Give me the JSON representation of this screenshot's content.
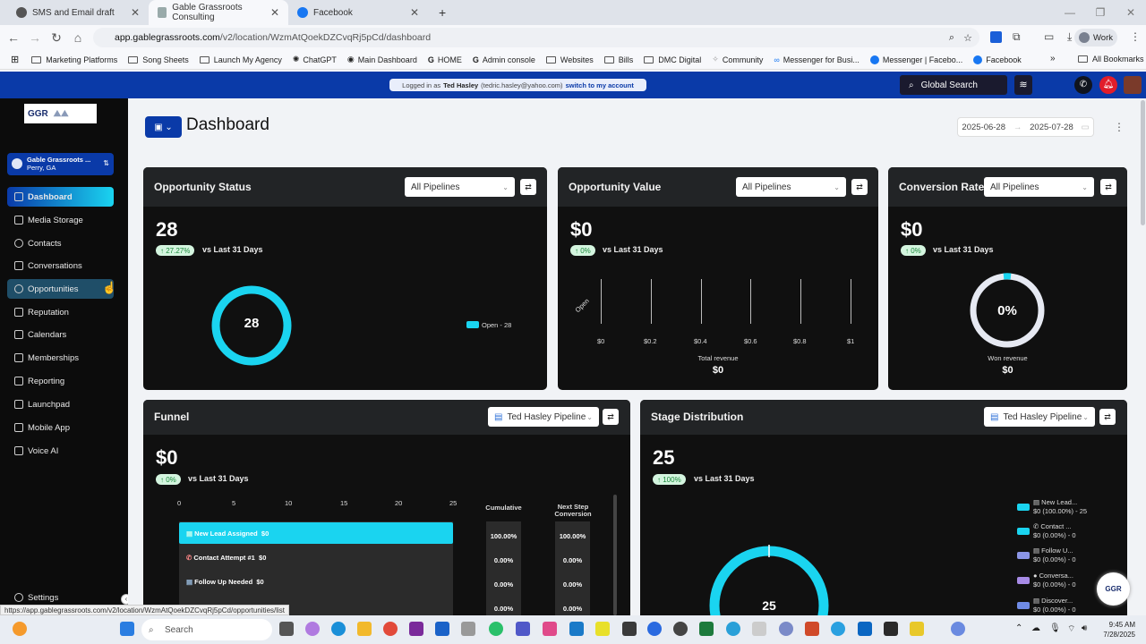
{
  "browser": {
    "tabs": [
      {
        "label": "SMS and Email draft"
      },
      {
        "label": "Gable Grassroots Consulting"
      },
      {
        "label": "Facebook"
      }
    ],
    "url_host": "app.gablegrassroots.com",
    "url_path": "/v2/location/WzmAtQoekDZCvqRj5pCd/dashboard",
    "profile": "Work",
    "bookmarks": [
      "Marketing Platforms",
      "Song Sheets",
      "Launch My Agency",
      "ChatGPT",
      "Main Dashboard",
      "HOME",
      "Admin console",
      "Websites",
      "Bills",
      "DMC Digital",
      "Community",
      "Messenger for Busi...",
      "Messenger | Facebo...",
      "Facebook"
    ],
    "all_bookmarks": "All Bookmarks"
  },
  "banner": {
    "prefix": "Logged in as",
    "user": "Ted Hasley",
    "email": "(tedric.hasley@yahoo.com)",
    "switch": "switch to my account"
  },
  "header": {
    "search": "Global Search"
  },
  "sidebar": {
    "logo": "GGR",
    "account_name": "Gable Grassroots ...",
    "account_loc": "Perry, GA",
    "items": [
      {
        "label": "Dashboard"
      },
      {
        "label": "Media Storage"
      },
      {
        "label": "Contacts"
      },
      {
        "label": "Conversations"
      },
      {
        "label": "Opportunities"
      },
      {
        "label": "Reputation"
      },
      {
        "label": "Calendars"
      },
      {
        "label": "Memberships"
      },
      {
        "label": "Reporting"
      },
      {
        "label": "Launchpad"
      },
      {
        "label": "Mobile App"
      },
      {
        "label": "Voice AI"
      }
    ],
    "settings": "Settings"
  },
  "page": {
    "title": "Dashboard",
    "date_from": "2025-06-28",
    "date_to": "2025-07-28"
  },
  "opp_status": {
    "title": "Opportunity Status",
    "select": "All Pipelines",
    "value": "28",
    "change": "↑ 27.27%",
    "vs": "vs Last 31 Days",
    "center": "28",
    "legend": "Open - 28"
  },
  "opp_value": {
    "title": "Opportunity Value",
    "select": "All Pipelines",
    "value": "$0",
    "change": "↑ 0%",
    "vs": "vs Last 31 Days",
    "ylabel": "Open",
    "xticks": [
      "$0",
      "$0.2",
      "$0.4",
      "$0.6",
      "$0.8",
      "$1"
    ],
    "total_label": "Total revenue",
    "total_value": "$0"
  },
  "conversion": {
    "title": "Conversion Rate",
    "select": "All Pipelines",
    "value": "$0",
    "change": "↑ 0%",
    "vs": "vs Last 31 Days",
    "center": "0%",
    "won_label": "Won revenue",
    "won_value": "$0"
  },
  "funnel": {
    "title": "Funnel",
    "select": "Ted Hasley Pipeline",
    "value": "$0",
    "change": "↑ 0%",
    "vs": "vs Last 31 Days",
    "xticks": [
      "0",
      "5",
      "10",
      "15",
      "20",
      "25"
    ],
    "col_cum": "Cumulative",
    "col_next": "Next Step Conversion",
    "rows": [
      {
        "label": "New Lead Assigned",
        "amount": "$0",
        "cum": "100.00%",
        "next": "100.00%"
      },
      {
        "label": "Contact Attempt #1",
        "amount": "$0",
        "cum": "0.00%",
        "next": "0.00%"
      },
      {
        "label": "Follow Up Needed",
        "amount": "$0",
        "cum": "0.00%",
        "next": "0.00%"
      },
      {
        "label": "",
        "amount": "",
        "cum": "0.00%",
        "next": "0.00%"
      }
    ]
  },
  "stage": {
    "title": "Stage Distribution",
    "select": "Ted Hasley Pipeline",
    "value": "25",
    "change": "↑ 100%",
    "vs": "vs Last 31 Days",
    "center": "25",
    "legend": [
      {
        "l1": "New Lead...",
        "l2": "$0 (100.00%) - 25"
      },
      {
        "l1": "Contact ...",
        "l2": "$0 (0.00%) - 0"
      },
      {
        "l1": "Follow U...",
        "l2": "$0 (0.00%) - 0"
      },
      {
        "l1": "Conversa...",
        "l2": "$0 (0.00%) - 0"
      },
      {
        "l1": "Discover...",
        "l2": "$0 (0.00%) - 0"
      }
    ]
  },
  "statusbar": {
    "url": "https://app.gablegrassroots.com/v2/location/WzmAtQoekDZCvqRj5pCd/opportunities/list"
  },
  "taskbar": {
    "search": "Search",
    "time": "9:45 AM",
    "date": "7/28/2025"
  }
}
